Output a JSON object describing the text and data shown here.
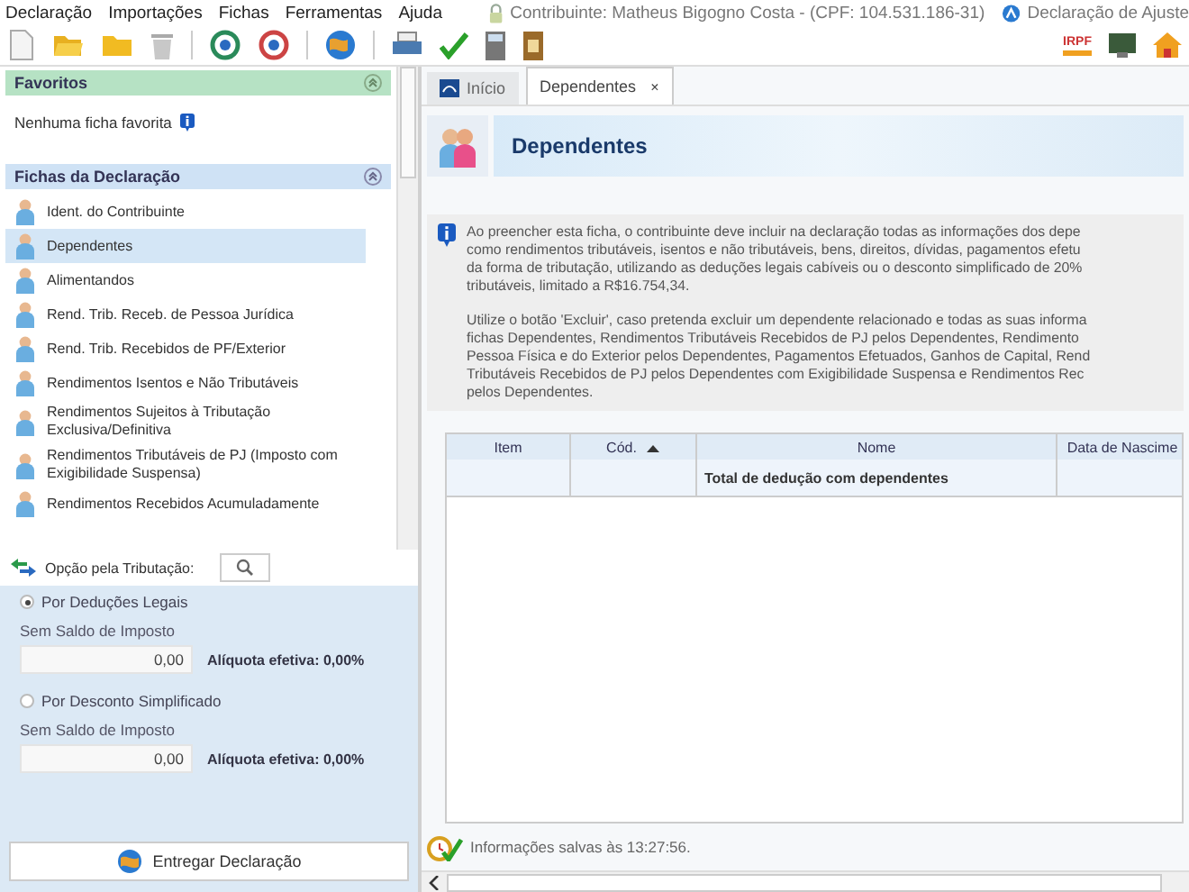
{
  "menu": [
    "Declaração",
    "Importações",
    "Fichas",
    "Ferramentas",
    "Ajuda"
  ],
  "contribuinte": "Contribuinte: Matheus Bigogno Costa - (CPF: 104.531.186-31)",
  "declaracao_tipo": "Declaração de Ajuste",
  "irpf_badge": "IRPF",
  "sidebar": {
    "favoritos": {
      "title": "Favoritos",
      "empty_text": "Nenhuma ficha favorita",
      "expanded": true
    },
    "fichas": {
      "title": "Fichas da Declaração",
      "expanded": true,
      "items": [
        {
          "label": "Ident. do Contribuinte",
          "selected": false
        },
        {
          "label": "Dependentes",
          "selected": true
        },
        {
          "label": "Alimentandos",
          "selected": false
        },
        {
          "label": "Rend. Trib. Receb. de Pessoa Jurídica",
          "selected": false
        },
        {
          "label": "Rend. Trib. Recebidos de PF/Exterior",
          "selected": false
        },
        {
          "label": "Rendimentos Isentos e Não Tributáveis",
          "selected": false
        },
        {
          "label": "Rendimentos Sujeitos à Tributação Exclusiva/Definitiva",
          "selected": false
        },
        {
          "label": "Rendimentos Tributáveis de PJ (Imposto com Exigibilidade Suspensa)",
          "selected": false
        },
        {
          "label": "Rendimentos Recebidos Acumuladamente",
          "selected": false
        }
      ]
    },
    "tributacao": {
      "title": "Opção pela Tributação:",
      "options": [
        {
          "label": "Por Deduções Legais",
          "selected": true,
          "field": {
            "label": "Sem Saldo de Imposto",
            "value": "0,00"
          },
          "aliquota": "Alíquota efetiva: 0,00%"
        },
        {
          "label": "Por Desconto Simplificado",
          "selected": false,
          "field": {
            "label": "Sem Saldo de Imposto",
            "value": "0,00"
          },
          "aliquota": "Alíquota efetiva: 0,00%"
        }
      ]
    },
    "submit_button": "Entregar Declaração"
  },
  "tabs": [
    {
      "label": "Início",
      "selected": false,
      "closable": false,
      "kind": "home"
    },
    {
      "label": "Dependentes",
      "selected": true,
      "closable": true,
      "kind": "form"
    }
  ],
  "close_glyph": "×",
  "page_title": "Dependentes",
  "info_paragraphs": [
    [
      "Ao preencher esta ficha, o contribuinte deve incluir na declaração todas as informações dos depe",
      "como rendimentos tributáveis, isentos e não tributáveis, bens, direitos, dívidas, pagamentos efetu",
      "da forma de tributação, utilizando as deduções legais cabíveis ou o desconto simplificado de 20%",
      "tributáveis, limitado a R$16.754,34."
    ],
    [
      "Utilize o botão 'Excluir', caso pretenda excluir um dependente relacionado e todas as suas informa",
      "fichas Dependentes, Rendimentos Tributáveis Recebidos de PJ pelos Dependentes, Rendimento",
      "Pessoa Física e do Exterior pelos Dependentes, Pagamentos Efetuados, Ganhos de Capital, Rend",
      "Tributáveis Recebidos de PJ pelos Dependentes com Exigibilidade Suspensa e Rendimentos Rec",
      "pelos Dependentes."
    ]
  ],
  "table": {
    "columns": [
      {
        "label": "Item",
        "sorted": false
      },
      {
        "label": "Cód.",
        "sorted": true
      },
      {
        "label": "Nome",
        "sorted": false
      },
      {
        "label": "Data de Nascime",
        "sorted": false
      }
    ],
    "total_row": {
      "label": "Total de dedução com dependentes"
    }
  },
  "status_bar": "Informações salvas às 13:27:56."
}
